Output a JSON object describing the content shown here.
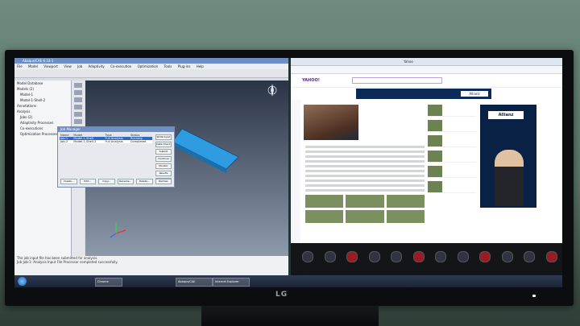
{
  "monitor_brand": "LG",
  "fea_app": {
    "title": "Abaqus/CAE 6.14-1",
    "menu": [
      "File",
      "Model",
      "Viewport",
      "View",
      "Job",
      "Adaptivity",
      "Co-execution",
      "Optimization",
      "Tools",
      "Plug-ins",
      "Help"
    ],
    "tree": [
      "Model Database",
      "Models (2)",
      "Model-1",
      "Model-1-Shell-2",
      "Annotations",
      "Analysis",
      "Jobs (2)",
      "Adaptivity Processes",
      "Co-executions",
      "Optimization Processes"
    ],
    "job_manager": {
      "title": "Job Manager",
      "columns": [
        "Name",
        "Model",
        "Type",
        "Status"
      ],
      "rows": [
        [
          "Job-1",
          "Model-1-Shell",
          "Full Analysis",
          "Running"
        ],
        [
          "Job-2",
          "Model-1-Shell-2",
          "Full Analysis",
          "Completed"
        ]
      ],
      "side_buttons": [
        "Write Input",
        "Data Check",
        "Submit",
        "Continue",
        "Monitor",
        "Results",
        "Kill"
      ],
      "bottom_buttons": [
        "Create...",
        "Edit...",
        "Copy...",
        "Rename...",
        "Delete...",
        "Dismiss"
      ]
    },
    "console": [
      "The job input file has been submitted for analysis.",
      "Job Job-1: Analysis Input File Processor completed successfully."
    ]
  },
  "browser": {
    "tab_label": "Yahoo",
    "logo": "YAHOO!",
    "ad_text": "Allianz",
    "side_ad_brand": "Allianz"
  },
  "taskbar": {
    "apps": [
      "Abaqus/CAE",
      "Chrome",
      "Internet Explorer"
    ],
    "clock_time": "",
    "clock_date": ""
  },
  "colors": {
    "abaqus_accent": "#6d8fc6",
    "fea_part": "#2f9be0",
    "job_running_highlight": "#3166c1",
    "yahoo_purple": "#5a1aa8",
    "allianz_navy": "#0a2146"
  }
}
